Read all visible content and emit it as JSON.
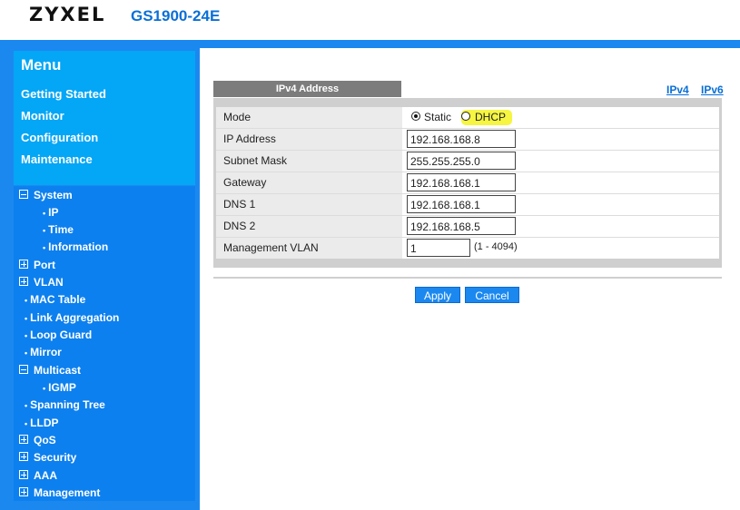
{
  "header": {
    "brand": "ZYXEL",
    "model": "GS1900-24E"
  },
  "menu": {
    "title": "Menu",
    "links": [
      "Getting Started",
      "Monitor",
      "Configuration",
      "Maintenance"
    ]
  },
  "tree": {
    "system": "System",
    "ip": "IP",
    "time": "Time",
    "information": "Information",
    "port": "Port",
    "vlan": "VLAN",
    "mac_table": "MAC Table",
    "link_aggregation": "Link Aggregation",
    "loop_guard": "Loop Guard",
    "mirror": "Mirror",
    "multicast": "Multicast",
    "igmp": "IGMP",
    "spanning_tree": "Spanning Tree",
    "lldp": "LLDP",
    "qos": "QoS",
    "security": "Security",
    "aaa": "AAA",
    "management": "Management"
  },
  "content": {
    "tab_label": "IPv4 Address",
    "link_ipv4": "IPv4",
    "link_ipv6": "IPv6",
    "form": {
      "mode_label": "Mode",
      "mode_static": "Static",
      "mode_dhcp": "DHCP",
      "mode_selected": "Static",
      "ip_label": "IP Address",
      "ip_value": "192.168.168.8",
      "mask_label": "Subnet Mask",
      "mask_value": "255.255.255.0",
      "gateway_label": "Gateway",
      "gateway_value": "192.168.168.1",
      "dns1_label": "DNS 1",
      "dns1_value": "192.168.168.1",
      "dns2_label": "DNS 2",
      "dns2_value": "192.168.168.5",
      "vlan_label": "Management VLAN",
      "vlan_value": "1",
      "vlan_range": "(1 - 4094)"
    },
    "apply_label": "Apply",
    "cancel_label": "Cancel"
  },
  "colors": {
    "accent": "#1b88f0",
    "menu_box": "#04a6f6",
    "highlight": "#f5f542"
  }
}
